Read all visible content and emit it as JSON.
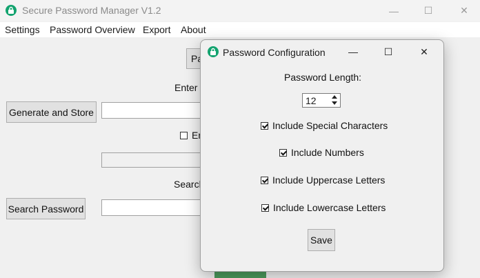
{
  "window": {
    "title": "Secure Password Manager V1.2",
    "minimize": "—",
    "maximize": "☐",
    "close": "✕"
  },
  "menu": [
    "Settings",
    "Password Overview",
    "Export",
    "About"
  ],
  "main": {
    "top_button_label": "Pa",
    "enter_label": "Enter a",
    "generate_button": "Generate and Store",
    "checkbox_label": "En",
    "search_label": "Search",
    "search_button": "Search Password"
  },
  "dialog": {
    "title": "Password Configuration",
    "minimize": "—",
    "maximize": "☐",
    "close": "✕",
    "length_label": "Password Length:",
    "length_value": "12",
    "options": [
      {
        "label": "Include Special Characters",
        "checked": true
      },
      {
        "label": "Include Numbers",
        "checked": true
      },
      {
        "label": "Include Uppercase Letters",
        "checked": true
      },
      {
        "label": "Include Lowercase Letters",
        "checked": true
      }
    ],
    "save_button": "Save"
  },
  "colors": {
    "accent_green": "#13a36f",
    "bottom_bar_green": "#4c9a5c"
  }
}
